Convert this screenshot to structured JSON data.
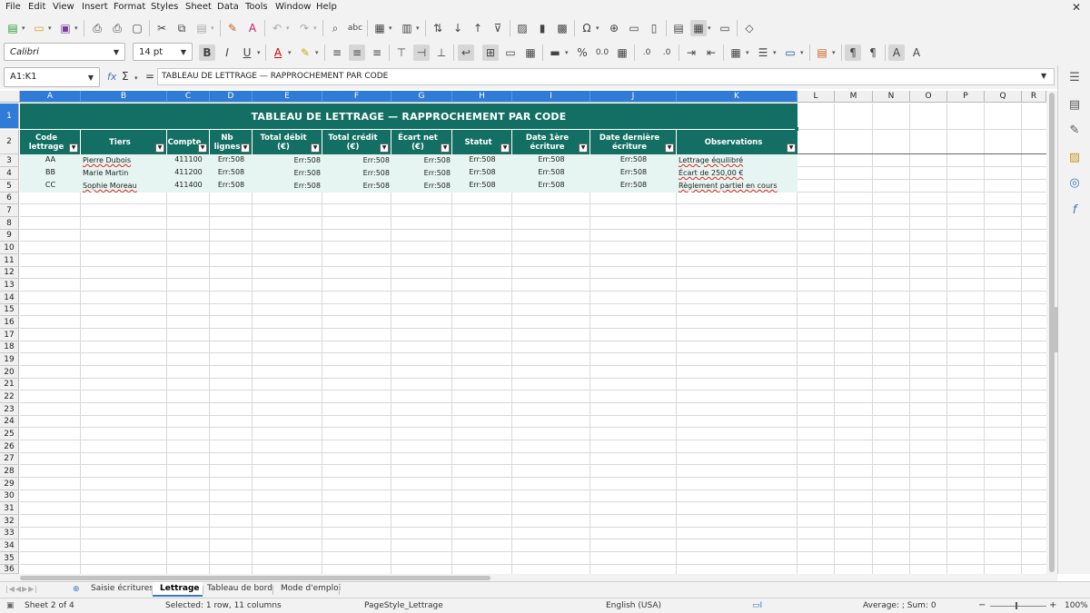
{
  "menu": [
    "File",
    "Edit",
    "View",
    "Insert",
    "Format",
    "Styles",
    "Sheet",
    "Data",
    "Tools",
    "Window",
    "Help"
  ],
  "toolbar": {
    "font_name": "Calibri",
    "font_size": "14 pt"
  },
  "formula_bar": {
    "name_box": "A1:K1",
    "function_wizard": "fx",
    "sum_symbol": "Σ",
    "equals": "=",
    "content": "TABLEAU DE LETTRAGE — RAPPROCHEMENT PAR CODE"
  },
  "columns": [
    "A",
    "B",
    "C",
    "D",
    "E",
    "F",
    "G",
    "H",
    "I",
    "J",
    "K",
    "L",
    "M",
    "N",
    "O",
    "P",
    "Q",
    "R"
  ],
  "rows": [
    "1",
    "2",
    "3",
    "4",
    "5",
    "6",
    "7",
    "8",
    "9",
    "10",
    "11",
    "12",
    "13",
    "14",
    "15",
    "16",
    "17",
    "18",
    "19",
    "20",
    "21",
    "22",
    "23",
    "24",
    "25",
    "26",
    "27",
    "28",
    "29",
    "30",
    "31",
    "32",
    "33",
    "34",
    "35",
    "36"
  ],
  "sheet": {
    "title": "TABLEAU DE LETTRAGE — RAPPROCHEMENT PAR CODE",
    "headers": [
      "Code lettrage",
      "Tiers",
      "Compte",
      "Nb lignes",
      "Total débit (€)",
      "Total crédit (€)",
      "Écart net (€)",
      "Statut",
      "Date 1ère écriture",
      "Date dernière écriture",
      "Observations"
    ],
    "data": [
      [
        "AA",
        "Pierre Dubois",
        "411100",
        "Err:508",
        "Err:508",
        "Err:508",
        "Err:508",
        "Err:508",
        "Err:508",
        "Err:508",
        "Lettrage équilibré"
      ],
      [
        "BB",
        "Marie Martin",
        "411200",
        "Err:508",
        "Err:508",
        "Err:508",
        "Err:508",
        "Err:508",
        "Err:508",
        "Err:508",
        "Écart de 250,00 €"
      ],
      [
        "CC",
        "Sophie Moreau",
        "411400",
        "Err:508",
        "Err:508",
        "Err:508",
        "Err:508",
        "Err:508",
        "Err:508",
        "Err:508",
        "Règlement partiel en cours"
      ]
    ]
  },
  "tabs": [
    "Saisie écritures",
    "Lettrage",
    "Tableau de bord",
    "Mode d'emploi"
  ],
  "active_tab": "Lettrage",
  "status": {
    "sheet": "Sheet 2 of 4",
    "selection": "Selected: 1 row, 11 columns",
    "page_style": "PageStyle_Lettrage",
    "language": "English (USA)",
    "sum": "Average: ; Sum: 0",
    "zoom": "100%"
  },
  "colors": {
    "header_bg": "#136f63",
    "selected_header": "#2f7bd8",
    "data_row_bg": "#e6f5f1",
    "error_squiggle": "#dd2222"
  }
}
